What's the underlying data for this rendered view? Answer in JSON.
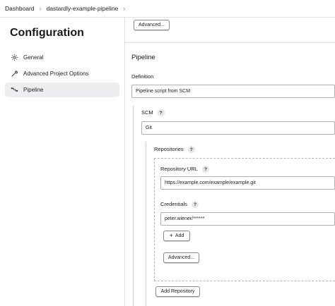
{
  "breadcrumb": {
    "items": [
      "Dashboard",
      "dastardly-example-pipeline"
    ],
    "separator": "›"
  },
  "sidebar": {
    "title": "Configuration",
    "items": [
      {
        "label": "General",
        "icon": "gear-icon",
        "active": false
      },
      {
        "label": "Advanced Project Options",
        "icon": "wrench-icon",
        "active": false
      },
      {
        "label": "Pipeline",
        "icon": "pipeline-icon",
        "active": true
      }
    ]
  },
  "main": {
    "top_advanced_label": "Advanced...",
    "pipeline_section_title": "Pipeline",
    "definition_label": "Definition",
    "definition_value": "Pipeline script from SCM",
    "scm_label": "SCM",
    "scm_value": "Git",
    "repositories_label": "Repositories",
    "repository_url_label": "Repository URL",
    "repository_url_value": "https://example.com/example/example.git",
    "credentials_label": "Credentials",
    "credentials_value": "peter.wiener/******",
    "add_button_label": "Add",
    "add_icon": "+",
    "repo_advanced_label": "Advanced...",
    "add_repository_label": "Add Repository",
    "help_glyph": "?"
  }
}
